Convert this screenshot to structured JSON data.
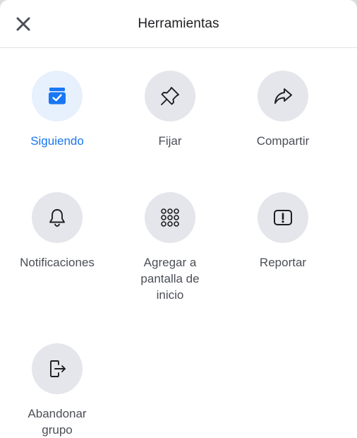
{
  "header": {
    "title": "Herramientas",
    "close_icon": "close-icon"
  },
  "tools": [
    {
      "key": "siguiendo",
      "label": "Siguiendo",
      "icon": "following-check-icon",
      "active": true
    },
    {
      "key": "fijar",
      "label": "Fijar",
      "icon": "pin-icon",
      "active": false
    },
    {
      "key": "compartir",
      "label": "Compartir",
      "icon": "share-icon",
      "active": false
    },
    {
      "key": "notificaciones",
      "label": "Notificaciones",
      "icon": "bell-icon",
      "active": false
    },
    {
      "key": "agregar",
      "label": "Agregar a\npantalla de\ninicio",
      "icon": "grid-dots-icon",
      "active": false
    },
    {
      "key": "reportar",
      "label": "Reportar",
      "icon": "report-icon",
      "active": false
    },
    {
      "key": "abandonar",
      "label": "Abandonar\ngrupo",
      "icon": "leave-group-icon",
      "active": false
    }
  ],
  "colors": {
    "accent": "#1877f2",
    "icon_bg": "#e4e6eb",
    "active_bg": "#e7f0fd",
    "label": "#4b4f56"
  }
}
